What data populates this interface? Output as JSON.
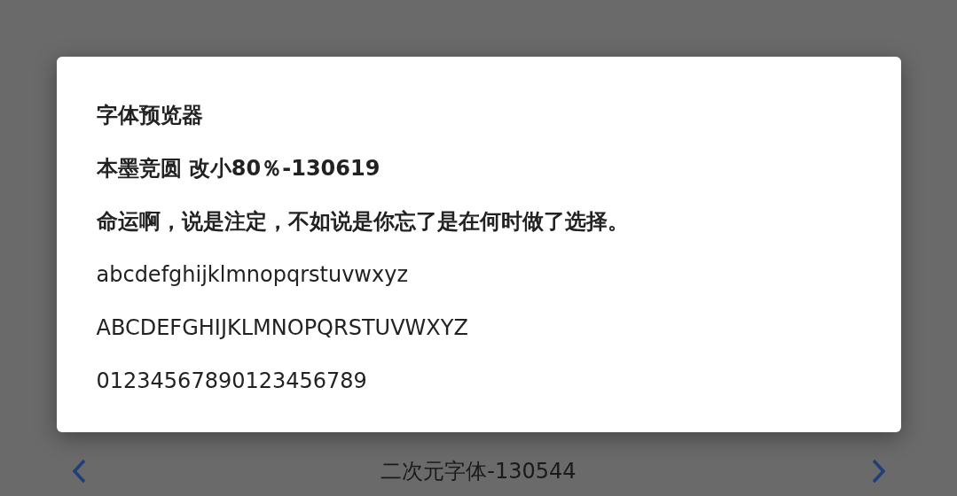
{
  "dialog": {
    "title": "字体预览器",
    "lines": [
      {
        "kind": "name",
        "text": "本墨竞圆  改小80％-130619"
      },
      {
        "kind": "sentence",
        "text": "命运啊，说是注定，不如说是你忘了是在何时做了选择。"
      },
      {
        "kind": "lower",
        "text": "abcdefghijklmnopqrstuvwxyz"
      },
      {
        "kind": "upper",
        "text": "ABCDEFGHIJKLMNOPQRSTUVWXYZ"
      },
      {
        "kind": "digits",
        "text": "01234567890123456789"
      }
    ]
  },
  "pager": {
    "title": "二次元字体-130544"
  }
}
